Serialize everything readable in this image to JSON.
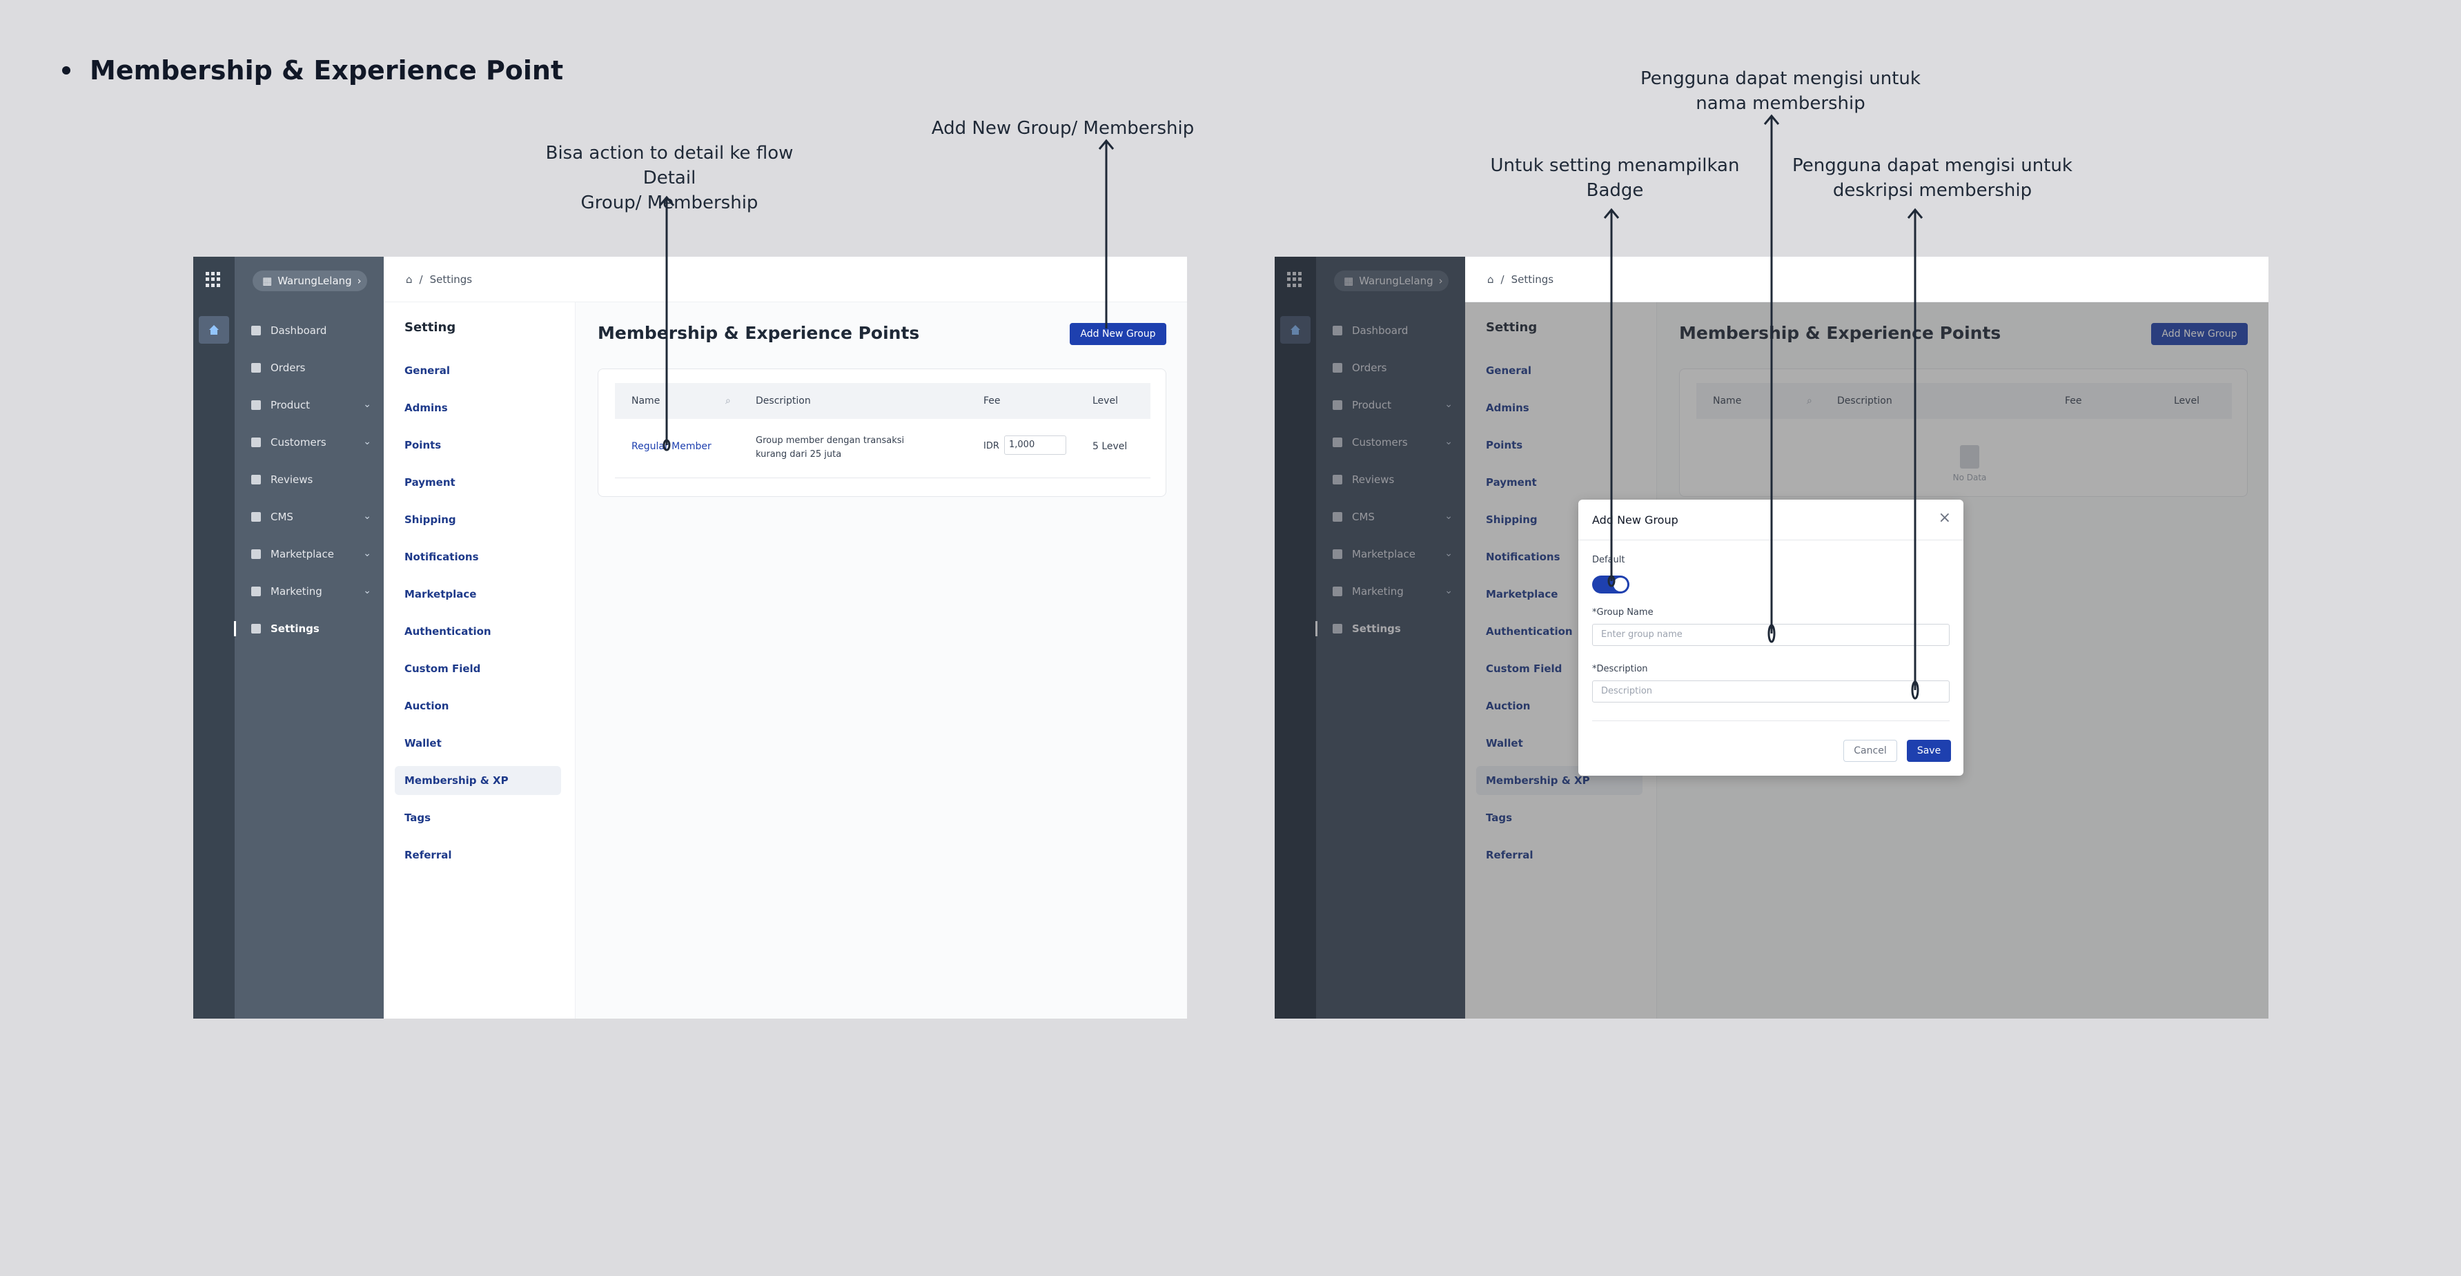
{
  "heading": "Membership & Experience Point",
  "annotations": {
    "left_detail": "Bisa action to detail ke flow Detail\nGroup/ Membership",
    "left_add": "Add New Group/ Membership",
    "right_badge": "Untuk setting menampilkan\nBadge",
    "right_name": "Pengguna dapat mengisi untuk\nnama membership",
    "right_desc": "Pengguna dapat mengisi untuk\ndeskripsi membership"
  },
  "app": {
    "workspace": "WarungLelang",
    "nav": [
      "Dashboard",
      "Orders",
      "Product",
      "Customers",
      "Reviews",
      "CMS",
      "Marketplace",
      "Marketing",
      "Settings"
    ],
    "breadcrumb": "Settings",
    "settings_heading": "Setting",
    "settings_menu": [
      "General",
      "Admins",
      "Points",
      "Payment",
      "Shipping",
      "Notifications",
      "Marketplace",
      "Authentication",
      "Custom Field",
      "Auction",
      "Wallet",
      "Membership & XP",
      "Tags",
      "Referral"
    ],
    "page_title": "Membership & Experience Points",
    "add_button": "Add New Group",
    "table": {
      "columns": [
        "Name",
        "Description",
        "Fee",
        "Level"
      ],
      "rows": [
        {
          "name": "Regular Member",
          "description": "Group member dengan transaksi kurang dari 25 juta",
          "currency": "IDR",
          "fee": "1,000",
          "level": "5 Level"
        }
      ]
    },
    "empty_text": "No Data"
  },
  "modal": {
    "title": "Add New Group",
    "default_label": "Default",
    "toggle_on": true,
    "group_name_label": "*Group Name",
    "group_name_placeholder": "Enter group name",
    "description_label": "*Description",
    "description_placeholder": "Description",
    "cancel": "Cancel",
    "save": "Save"
  },
  "colors": {
    "accent": "#1e40af",
    "sidebar": "#535f6d",
    "rail": "#394450",
    "link": "#1e3a8a"
  }
}
